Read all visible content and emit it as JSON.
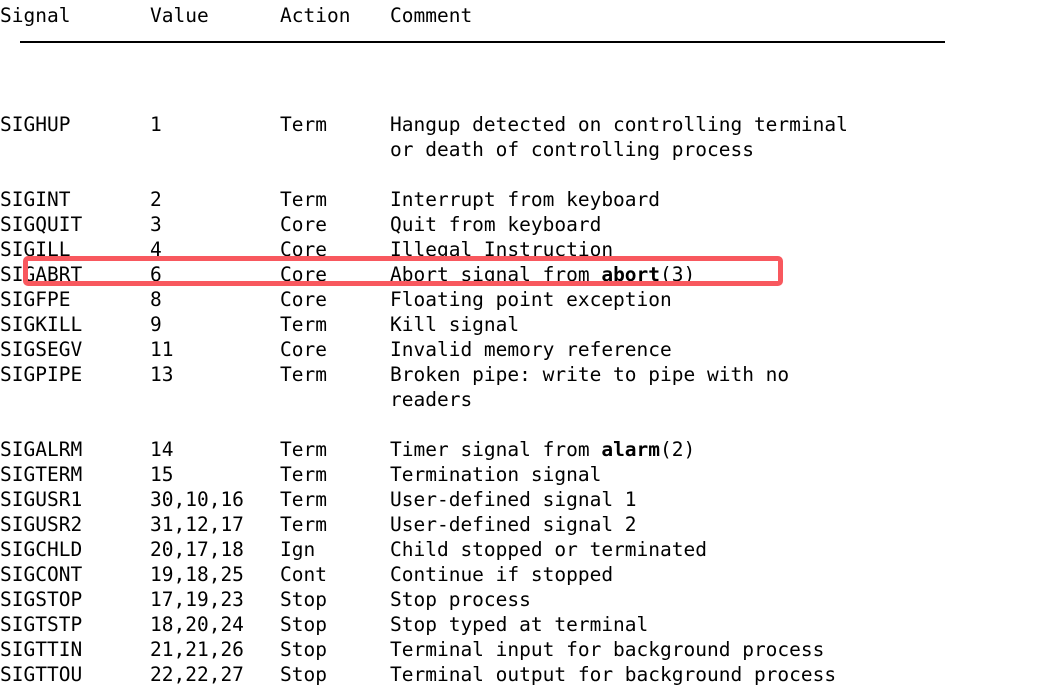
{
  "document": {
    "type": "man-page-signal-table",
    "font_style": "monospace"
  },
  "table": {
    "headers": {
      "signal": "Signal",
      "value": "Value",
      "action": "Action",
      "comment": "Comment"
    },
    "rows": [
      {
        "signal": "SIGHUP",
        "value": "1",
        "action": "Term",
        "comment_line1": "Hangup detected on controlling terminal",
        "comment_line2": "or death of controlling process"
      },
      {
        "signal": "SIGINT",
        "value": "2",
        "action": "Term",
        "comment_line1": "Interrupt from keyboard",
        "comment_line2": ""
      },
      {
        "signal": "SIGQUIT",
        "value": "3",
        "action": "Core",
        "comment_line1": "Quit from keyboard",
        "comment_line2": ""
      },
      {
        "signal": "SIGILL",
        "value": "4",
        "action": "Core",
        "comment_line1": "Illegal Instruction",
        "comment_line2": ""
      },
      {
        "signal": "SIGABRT",
        "value": "6",
        "action": "Core",
        "comment_pre": "Abort signal from ",
        "comment_bold": "abort",
        "comment_post": "(3)",
        "comment_line2": ""
      },
      {
        "signal": "SIGFPE",
        "value": "8",
        "action": "Core",
        "comment_line1": "Floating point exception",
        "comment_line2": ""
      },
      {
        "signal": "SIGKILL",
        "value": "9",
        "action": "Term",
        "comment_line1": "Kill signal",
        "comment_line2": ""
      },
      {
        "signal": "SIGSEGV",
        "value": "11",
        "action": "Core",
        "comment_line1": "Invalid memory reference",
        "comment_line2": "",
        "highlighted": true
      },
      {
        "signal": "SIGPIPE",
        "value": "13",
        "action": "Term",
        "comment_line1": "Broken pipe: write to pipe with no",
        "comment_line2": "readers"
      },
      {
        "signal": "SIGALRM",
        "value": "14",
        "action": "Term",
        "comment_pre": "Timer signal from ",
        "comment_bold": "alarm",
        "comment_post": "(2)",
        "comment_line2": ""
      },
      {
        "signal": "SIGTERM",
        "value": "15",
        "action": "Term",
        "comment_line1": "Termination signal",
        "comment_line2": ""
      },
      {
        "signal": "SIGUSR1",
        "value": "30,10,16",
        "action": "Term",
        "comment_line1": "User-defined signal 1",
        "comment_line2": ""
      },
      {
        "signal": "SIGUSR2",
        "value": "31,12,17",
        "action": "Term",
        "comment_line1": "User-defined signal 2",
        "comment_line2": ""
      },
      {
        "signal": "SIGCHLD",
        "value": "20,17,18",
        "action": "Ign",
        "comment_line1": "Child stopped or terminated",
        "comment_line2": ""
      },
      {
        "signal": "SIGCONT",
        "value": "19,18,25",
        "action": "Cont",
        "comment_line1": "Continue if stopped",
        "comment_line2": ""
      },
      {
        "signal": "SIGSTOP",
        "value": "17,19,23",
        "action": "Stop",
        "comment_line1": "Stop process",
        "comment_line2": ""
      },
      {
        "signal": "SIGTSTP",
        "value": "18,20,24",
        "action": "Stop",
        "comment_line1": "Stop typed at terminal",
        "comment_line2": ""
      },
      {
        "signal": "SIGTTIN",
        "value": "21,21,26",
        "action": "Stop",
        "comment_line1": "Terminal input for background process",
        "comment_line2": ""
      },
      {
        "signal": "SIGTTOU",
        "value": "22,22,27",
        "action": "Stop",
        "comment_line1": "Terminal output for background process",
        "comment_line2": ""
      }
    ]
  },
  "annotation": {
    "type": "highlight-rectangle",
    "target_signal": "SIGSEGV",
    "color": "#f8585e"
  }
}
